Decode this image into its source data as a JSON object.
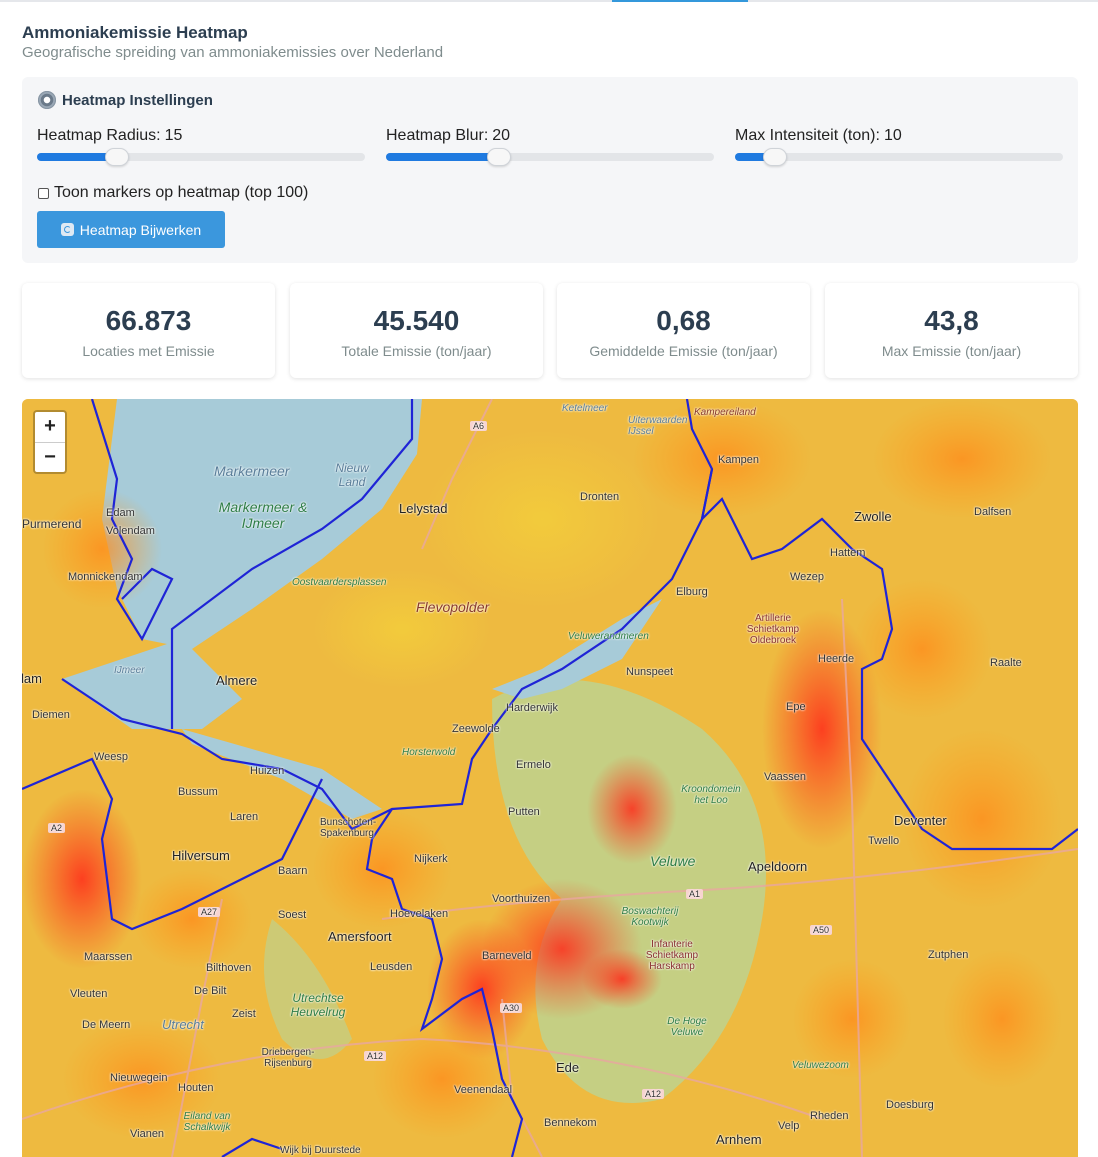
{
  "page": {
    "title": "Ammoniakemissie Heatmap",
    "subtitle": "Geografische spreiding van ammoniakemissies over Nederland"
  },
  "settings": {
    "title": "Heatmap Instellingen",
    "icon": "gear-icon",
    "radius": {
      "label": "Heatmap Radius:",
      "value": "15",
      "fraction": 0.24
    },
    "blur": {
      "label": "Heatmap Blur:",
      "value": "20",
      "fraction": 0.34
    },
    "max_intensity": {
      "label": "Max Intensiteit (ton):",
      "value": "10",
      "fraction": 0.12
    },
    "markers_checkbox": {
      "label": "Toon markers op heatmap (top 100)",
      "checked": false
    },
    "update_button": {
      "label": "Heatmap Bijwerken",
      "icon": "refresh-icon"
    },
    "accent_color": "#1f7ae0",
    "button_color": "#3b97dd"
  },
  "stats": [
    {
      "value": "66.873",
      "caption": "Locaties met Emissie"
    },
    {
      "value": "45.540",
      "caption": "Totale Emissie (ton/jaar)"
    },
    {
      "value": "0,68",
      "caption": "Gemiddelde Emissie (ton/jaar)"
    },
    {
      "value": "43,8",
      "caption": "Max Emissie (ton/jaar)"
    }
  ],
  "map": {
    "zoom_in": "+",
    "zoom_out": "−",
    "labels": {
      "markermeer_water": "Markermeer",
      "nieuw_land": "Nieuw Land",
      "markermeer_ijmeer": "Markermeer & IJmeer",
      "lelystad": "Lelystad",
      "dronten": "Dronten",
      "kampen": "Kampen",
      "kampereiland": "Kampereiland",
      "ketelmeer": "Ketelmeer",
      "uiterwaarden": "Uiterwaarden IJssel",
      "zwolle": "Zwolle",
      "dalfsen": "Dalfsen",
      "hattem": "Hattem",
      "wezep": "Wezep",
      "elburg": "Elburg",
      "purmerend": "Purmerend",
      "edam": "Edam",
      "volendam": "Volendam",
      "monnickendam": "Monnickendam",
      "oostvaardersplassen": "Oostvaardersplassen",
      "flevopolder": "Flevopolder",
      "veluwerandmeren": "Veluwerandmeren",
      "artillerie": "Artillerie Schietkamp Oldebroek",
      "heerde": "Heerde",
      "raalte": "Raalte",
      "ijmeer": "IJmeer",
      "amsterdam": "Amsterdam",
      "almere": "Almere",
      "diemen": "Diemen",
      "nunspeet": "Nunspeet",
      "harderwijk": "Harderwijk",
      "epe": "Epe",
      "zeewolde": "Zeewolde",
      "horsterwold": "Horsterwold",
      "weesp": "Weesp",
      "huizen": "Huizen",
      "ermelo": "Ermelo",
      "vaassen": "Vaassen",
      "bussum": "Bussum",
      "laren": "Laren",
      "bunschoten": "Bunschoten-Spakenburg",
      "putten": "Putten",
      "kroondomein": "Kroondomein het Loo",
      "deventer": "Deventer",
      "twello": "Twello",
      "hilversum": "Hilversum",
      "nijkerk": "Nijkerk",
      "veluwe": "Veluwe",
      "apeldoorn": "Apeldoorn",
      "baarn": "Baarn",
      "voorthuizen": "Voorthuizen",
      "soest": "Soest",
      "hoevelaken": "Hoevelaken",
      "boswachterij": "Boswachterij Kootwijk",
      "amersfoort": "Amersfoort",
      "infanterie": "Infanterie Schietkamp Harskamp",
      "maarssen": "Maarssen",
      "bilthoven": "Bilthoven",
      "leusden": "Leusden",
      "barneveld": "Barneveld",
      "zutphen": "Zutphen",
      "maarssen2": "Maarssen",
      "debilt": "De Bilt",
      "utrechtse_heuvelrug": "Utrechtse Heuvelrug",
      "vleuten": "Vleuten",
      "zeist": "Zeist",
      "demeern": "De Meern",
      "utrecht": "Utrecht",
      "hoge_veluwe": "De Hoge Veluwe",
      "driebergen": "Driebergen-Rijsenburg",
      "ede": "Ede",
      "veluwezoom": "Veluwezoom",
      "nieuwegein": "Nieuwegein",
      "houten": "Houten",
      "veenendaal": "Veenendaal",
      "rheden": "Rheden",
      "doesburg": "Doesburg",
      "eiland": "Eiland van Schalkwijk",
      "vianen": "Vianen",
      "bennekom": "Bennekom",
      "velp": "Velp",
      "wijk": "Wijk bij Duurstede",
      "arnhem": "Arnhem",
      "a6": "A6",
      "a1": "A1",
      "a50": "A50",
      "a30": "A30",
      "a12": "A12",
      "a12b": "A12",
      "a27": "A27",
      "a2": "A2"
    }
  }
}
